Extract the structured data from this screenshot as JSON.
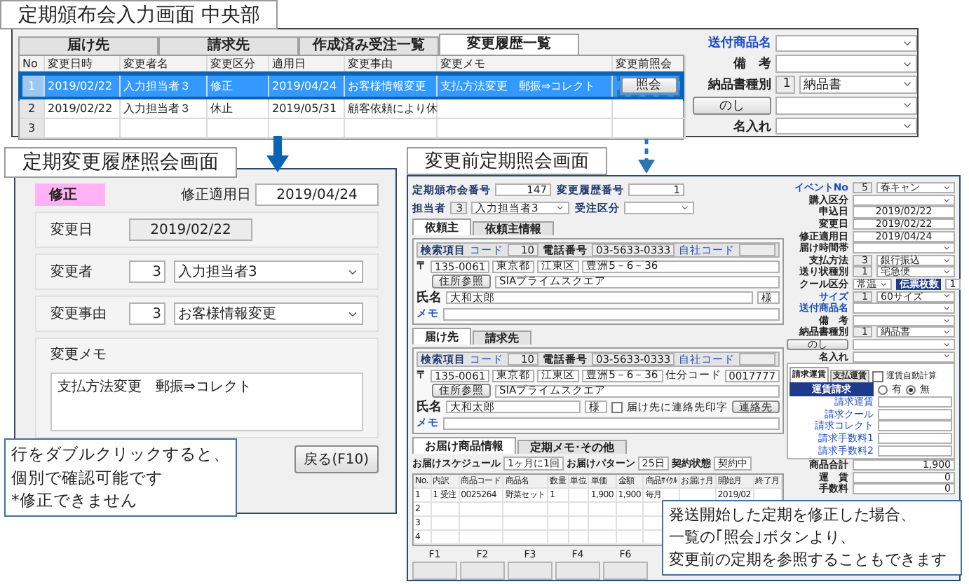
{
  "main_screen": {
    "caption": "定期頒布会入力画面 中央部",
    "tabs": [
      {
        "label": "届け先",
        "selected": false
      },
      {
        "label": "請求先",
        "selected": false
      },
      {
        "label": "作成済み受注一覧",
        "selected": false
      },
      {
        "label": "変更履歴一覧",
        "selected": true
      }
    ],
    "columns": [
      "No",
      "変更日時",
      "変更者名",
      "変更区分",
      "適用日",
      "変更事由",
      "変更メモ",
      "変更前照会"
    ],
    "rows": [
      {
        "no": "1",
        "cells": [
          "2019/02/22",
          "入力担当者３",
          "修正",
          "2019/04/24",
          "お客様情報変更",
          "支払方法変更　郵振⇒コレクト"
        ],
        "button": "照会",
        "selected": true
      },
      {
        "no": "2",
        "cells": [
          "2019/02/22",
          "入力担当者３",
          "休止",
          "2019/05/31",
          "顧客依頼により休"
        ],
        "selected": false
      },
      {
        "no": "3",
        "selected": false
      }
    ],
    "fields": [
      {
        "kind": "select",
        "label": "送付商品名",
        "link": true
      },
      {
        "kind": "select",
        "label": "備　考"
      },
      {
        "kind": "select",
        "label": "納品書種別",
        "code": "1",
        "value": "納品書"
      },
      {
        "kind": "button",
        "label": "のし"
      },
      {
        "kind": "select",
        "label": "名入れ"
      }
    ]
  },
  "history_dialog": {
    "caption": "定期変更履歴照会画面",
    "type_badge": "修正",
    "apply_date_label": "修正適用日",
    "apply_date": "2019/04/24",
    "change_date_label": "変更日",
    "change_date": "2019/02/22",
    "pickers": [
      {
        "label": "変更者",
        "code": "3",
        "value": "入力担当者3"
      },
      {
        "label": "変更事由",
        "code": "3",
        "value": "お客様情報変更"
      }
    ],
    "memo_label": "変更メモ",
    "memo": "支払方法変更　郵振⇒コレクト",
    "back_button": "戻る(F10)"
  },
  "note_left": [
    "行をダブルクリックすると、",
    "個別で確認可能です",
    "*修正できません"
  ],
  "before_screen": {
    "caption": "変更前定期照会画面",
    "header": [
      {
        "label": "定期頒布会番号",
        "value": "147"
      },
      {
        "label": "変更履歴番号",
        "value": "1"
      },
      {
        "label": "担当者",
        "code": "3",
        "value": "入力担当者3"
      },
      {
        "label": "受注区分"
      }
    ],
    "client_tabs": [
      {
        "label": "依頼主",
        "selected": true
      },
      {
        "label": "依頼主情報",
        "selected": false
      }
    ],
    "client": {
      "search_label": "検索項目",
      "code_label": "コード",
      "code": "10",
      "phone_label": "電話番号",
      "phone": "03-5633-0333",
      "own_code_label": "自社コード",
      "postal_mark": "〒",
      "zip": "135-0061",
      "pref": "東京都",
      "city": "江東区",
      "street": "豊洲5－6－36",
      "address_button": "住所参照",
      "building": "SIAプライムスクエア",
      "name_label": "氏名",
      "name": "大和太郎",
      "honorific": "様",
      "memo_label": "メモ"
    },
    "dest_tabs": [
      {
        "label": "届け先",
        "selected": true
      },
      {
        "label": "請求先",
        "selected": false
      }
    ],
    "dest": {
      "search_label": "検索項目",
      "code_label": "コード",
      "code": "10",
      "phone_label": "電話番号",
      "phone": "03-5633-0333",
      "own_code_label": "自社コード",
      "postal_mark": "〒",
      "zip": "135-0061",
      "pref": "東京都",
      "city": "江東区",
      "street": "豊洲5－6－36",
      "sort_label": "仕分コード",
      "sort_code": "0017777",
      "address_button": "住所参照",
      "building": "SIAプライムスクエア",
      "name_label": "氏名",
      "name": "大和太郎",
      "honorific": "様",
      "memo_label": "メモ",
      "print_check": {
        "label": "届け先に連絡先印字",
        "checked": false
      },
      "contact_button": "連絡先"
    },
    "product_tabs": [
      {
        "label": "お届け商品情報",
        "selected": true
      },
      {
        "label": "定期メモ･その他",
        "selected": false
      }
    ],
    "schedule": [
      {
        "label": "お届けスケジュール",
        "value": "1ヶ月に1回"
      },
      {
        "label": "お届けパターン",
        "value": "25日"
      },
      {
        "label": "契約状態",
        "value": "契約中"
      }
    ],
    "product_columns": [
      "No.",
      "内訳",
      "商品コード",
      "商品名",
      "数量",
      "単位",
      "単価",
      "金額",
      "商品ｻｲｸﾙ",
      "お届け月",
      "開始月",
      "終了月"
    ],
    "product_rows": [
      [
        "1",
        "1 受注",
        "0025264",
        "野菜セット",
        "1",
        null,
        "1,900",
        "1,900",
        "毎月",
        null,
        "2019/02",
        null
      ],
      [
        "2"
      ],
      [
        "3"
      ],
      [
        "4"
      ]
    ],
    "function_keys": [
      "F1",
      "F2",
      "F3",
      "F4",
      "F6"
    ],
    "side_fields": [
      {
        "kind": "select",
        "label": "イベントNo",
        "code": "5",
        "value": "春キャン",
        "link": true
      },
      {
        "kind": "select",
        "label": "購入区分"
      },
      {
        "kind": "date",
        "label": "申込日",
        "value": "2019/02/22"
      },
      {
        "kind": "date",
        "label": "変更日",
        "value": "2019/02/22"
      },
      {
        "kind": "date",
        "label": "修正適用日",
        "value": "2019/04/24"
      },
      {
        "kind": "select",
        "label": "届け時間帯"
      },
      {
        "kind": "select",
        "label": "支払方法",
        "code": "3",
        "value": "銀行振込"
      },
      {
        "kind": "select",
        "label": "送り状種別",
        "code": "1",
        "value": "宅急便"
      },
      {
        "kind": "cool",
        "label": "クール区分",
        "value": "常温",
        "extra_label": "伝票枚数",
        "extra": "1"
      },
      {
        "kind": "select",
        "label": "サイズ",
        "code": "1",
        "value": "60サイズ",
        "link": true
      },
      {
        "kind": "select",
        "label": "送付商品名",
        "link": true
      },
      {
        "kind": "select",
        "label": "備　考"
      },
      {
        "kind": "select",
        "label": "納品書種別",
        "code": "1",
        "value": "納品書"
      },
      {
        "kind": "button",
        "label": "のし"
      },
      {
        "kind": "select",
        "label": "名入れ"
      }
    ],
    "billing": {
      "tabs": [
        {
          "label": "請求運賃",
          "selected": true
        },
        {
          "label": "支払運賃",
          "selected": false
        }
      ],
      "auto_check": {
        "label": "運賃自動計算",
        "checked": false
      },
      "mode_label": "運賃請求",
      "options": [
        {
          "label": "有",
          "selected": false
        },
        {
          "label": "無",
          "selected": true
        }
      ],
      "fields": [
        "請求運賃",
        "請求クール",
        "請求コレクト",
        "請求手数料1",
        "請求手数料2"
      ]
    },
    "totals": [
      {
        "label": "商品合計",
        "value": "1,900"
      },
      {
        "label": "運　賃",
        "value": "0"
      },
      {
        "label": "手数料",
        "value": "0"
      }
    ]
  },
  "note_right": [
    "発送開始した定期を修正した場合、",
    "一覧の｢照会｣ボタンより、",
    "変更前の定期を参照することもできます"
  ]
}
